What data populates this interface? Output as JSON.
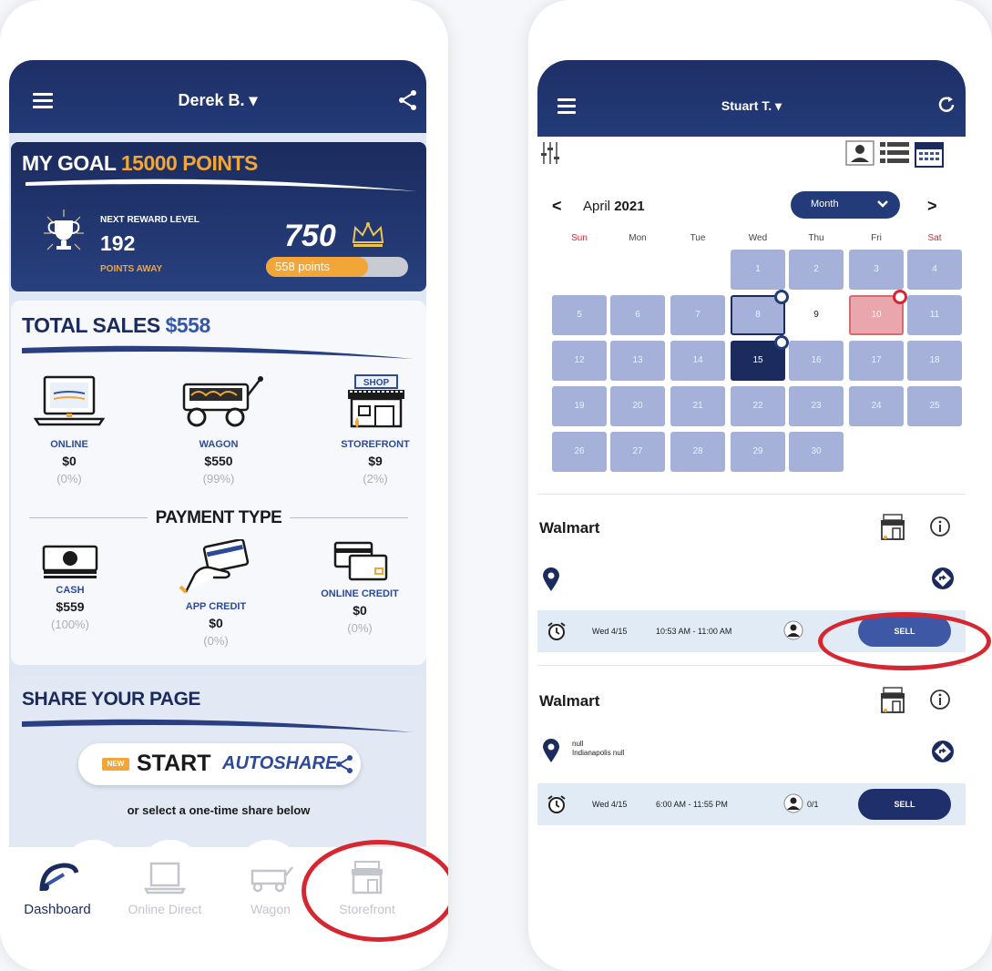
{
  "left": {
    "header": {
      "user": "Derek B. ▾"
    },
    "goal": {
      "title_prefix": "MY GOAL ",
      "title_value": "15000 POINTS",
      "next_reward_label": "NEXT REWARD LEVEL",
      "points_remaining": "192",
      "points_away_label": "POINTS AWAY",
      "current_points": "750",
      "progress_label": "558 points",
      "progress_fraction": 0.72
    },
    "sales": {
      "title_prefix": "TOTAL SALES ",
      "title_value": "$558",
      "channels": [
        {
          "name": "ONLINE",
          "value": "$0",
          "percent": "(0%)"
        },
        {
          "name": "WAGON",
          "value": "$550",
          "percent": "(99%)"
        },
        {
          "name": "STOREFRONT",
          "value": "$9",
          "percent": "(2%)"
        }
      ],
      "payment_title": "PAYMENT TYPE",
      "payments": [
        {
          "name": "CASH",
          "value": "$559",
          "percent": "(100%)"
        },
        {
          "name": "APP CREDIT",
          "value": "$0",
          "percent": "(0%)"
        },
        {
          "name": "ONLINE CREDIT",
          "value": "$0",
          "percent": "(0%)"
        }
      ],
      "shop_sign": "SHOP"
    },
    "share": {
      "title": "SHARE YOUR PAGE",
      "new_badge": "NEW",
      "start_label": "START",
      "autoshare_label": "AUTOSHARE",
      "or_text": "or select a one-time share below"
    },
    "tabs": [
      {
        "label": "Dashboard",
        "icon": "dashboard-icon",
        "active": true
      },
      {
        "label": "Online Direct",
        "icon": "laptop-icon",
        "active": false
      },
      {
        "label": "Wagon",
        "icon": "wagon-icon",
        "active": false
      },
      {
        "label": "Storefront",
        "icon": "storefront-icon",
        "active": false
      }
    ],
    "highlight_color": "#d6262f"
  },
  "right": {
    "header": {
      "user": "Stuart T. ▾"
    },
    "calendar": {
      "month": "April",
      "year": "2021",
      "view": "Month",
      "nav_prev": "<",
      "nav_next": ">",
      "weekdays": [
        "Sun",
        "Mon",
        "Tue",
        "Wed",
        "Thu",
        "Fri",
        "Sat"
      ],
      "days": [
        [
          "",
          "",
          "",
          "1",
          "2",
          "3",
          "4"
        ],
        [
          "5",
          "6",
          "7",
          "8",
          "9",
          "10",
          "11"
        ],
        [
          "12",
          "13",
          "14",
          "15",
          "16",
          "17",
          "18"
        ],
        [
          "19",
          "20",
          "21",
          "22",
          "23",
          "24",
          "25"
        ],
        [
          "26",
          "27",
          "28",
          "29",
          "30",
          "",
          ""
        ]
      ],
      "selected_day": "15",
      "outlined_day": "8",
      "plain_day": "9",
      "flagged_day": "10"
    },
    "appointments": [
      {
        "store": "Walmart",
        "address_line1": "",
        "address_line2": "",
        "date": "Wed 4/15",
        "time": "10:53 AM - 11:00 AM",
        "count": "",
        "sell_label": "SELL"
      },
      {
        "store": "Walmart",
        "address_line1": "null",
        "address_line2": "Indianapolis null",
        "date": "Wed 4/15",
        "time": "6:00 AM - 11:55 PM",
        "count": "0/1",
        "sell_label": "SELL"
      }
    ]
  }
}
